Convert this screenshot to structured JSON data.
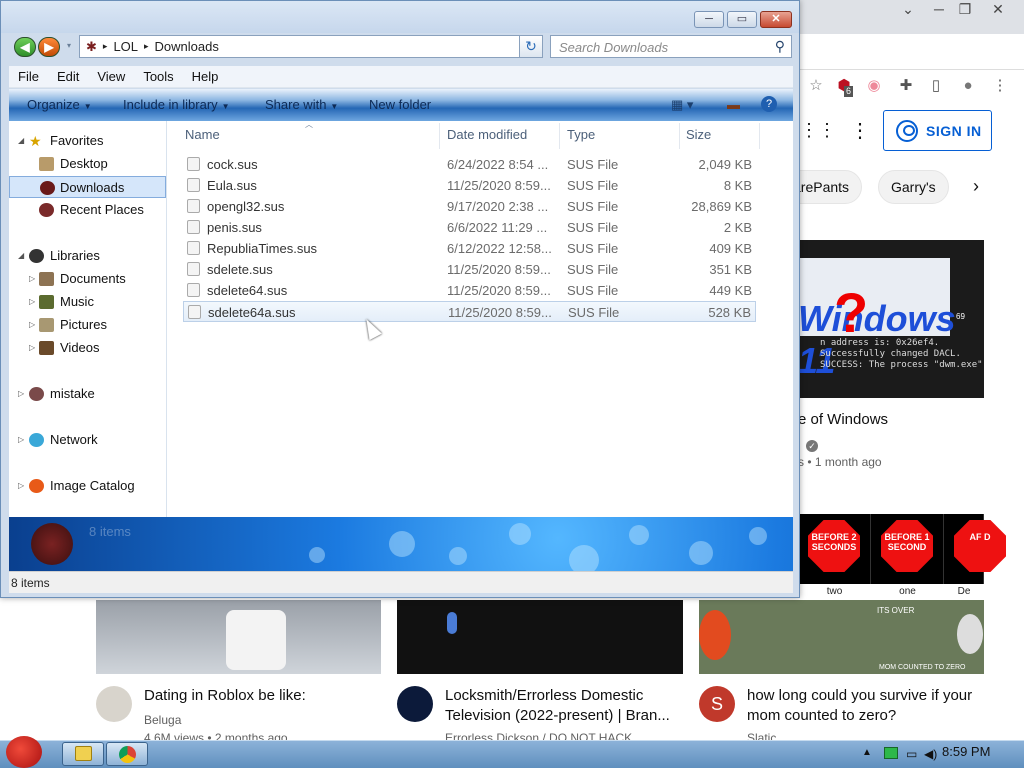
{
  "browser": {
    "window_controls": [
      "⌄",
      "─",
      "❐",
      "✕"
    ],
    "sign_in_label": "SIGN IN",
    "ext_badge": "6",
    "chips": [
      "arePants",
      "Garry's"
    ],
    "videos": [
      {
        "title": "e of Windows",
        "meta": "s • 1 month ago"
      },
      {
        "title": "Dating in Roblox be like:",
        "channel": "Beluga",
        "meta": "4.6M views • 2 months ago"
      },
      {
        "title": "Locksmith/Errorless Domestic Television (2022-present) | Bran...",
        "channel": "Errorless Dickson / DO NOT HACK...",
        "meta": ""
      },
      {
        "title": "how long could you survive if your mom counted to zero?",
        "channel": "Slatic",
        "meta": ""
      }
    ],
    "thumb1": {
      "title": "Windows 11",
      "terminal": "n address is: 0x26ef4.\nSuccessfully changed DACL.\nSUCCESS: The process \"dwm.exe\" wit",
      "badge": "69"
    },
    "shorts": [
      {
        "sign": "BEFORE 2 SECONDS",
        "label": "two"
      },
      {
        "sign": "BEFORE 1 SECOND",
        "label": "one"
      },
      {
        "sign": "AF D",
        "label": "De"
      }
    ],
    "thumb4_caption": "MOM COUNTED TO ZERO",
    "thumb4_caption2": "ITS OVER",
    "avatar_letter": "S"
  },
  "explorer": {
    "breadcrumb": [
      "LOL",
      "Downloads"
    ],
    "search_placeholder": "Search Downloads",
    "menu": [
      "File",
      "Edit",
      "View",
      "Tools",
      "Help"
    ],
    "commands": [
      "Organize",
      "Include in library",
      "Share with",
      "New folder"
    ],
    "columns": [
      "Name",
      "Date modified",
      "Type",
      "Size"
    ],
    "nav": {
      "favorites": "Favorites",
      "desktop": "Desktop",
      "downloads": "Downloads",
      "recent": "Recent Places",
      "libraries": "Libraries",
      "documents": "Documents",
      "music": "Music",
      "pictures": "Pictures",
      "videos": "Videos",
      "mistake": "mistake",
      "network": "Network",
      "catalog": "Image Catalog"
    },
    "files": [
      {
        "name": "cock.sus",
        "date": "6/24/2022 8:54 ...",
        "type": "SUS File",
        "size": "2,049 KB"
      },
      {
        "name": "Eula.sus",
        "date": "11/25/2020 8:59...",
        "type": "SUS File",
        "size": "8 KB"
      },
      {
        "name": "opengl32.sus",
        "date": "9/17/2020 2:38 ...",
        "type": "SUS File",
        "size": "28,869 KB"
      },
      {
        "name": "penis.sus",
        "date": "6/6/2022 11:29 ...",
        "type": "SUS File",
        "size": "2 KB"
      },
      {
        "name": "RepubliaTimes.sus",
        "date": "6/12/2022 12:58...",
        "type": "SUS File",
        "size": "409 KB"
      },
      {
        "name": "sdelete.sus",
        "date": "11/25/2020 8:59...",
        "type": "SUS File",
        "size": "351 KB"
      },
      {
        "name": "sdelete64.sus",
        "date": "11/25/2020 8:59...",
        "type": "SUS File",
        "size": "449 KB"
      },
      {
        "name": "sdelete64a.sus",
        "date": "11/25/2020 8:59...",
        "type": "SUS File",
        "size": "528 KB"
      }
    ],
    "details_count": "8 items",
    "status": "8 items"
  },
  "taskbar": {
    "clock": "8:59 PM"
  }
}
